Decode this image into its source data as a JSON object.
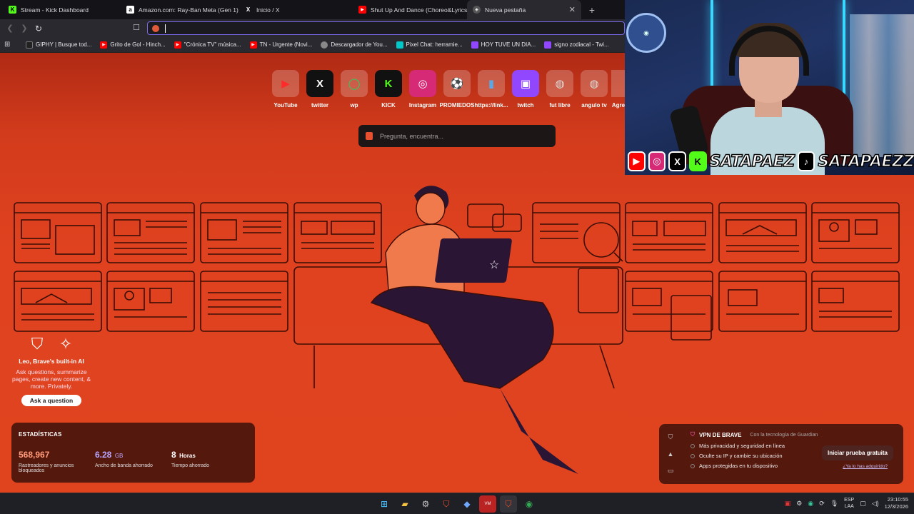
{
  "tabs": [
    {
      "title": "Stream - Kick Dashboard",
      "icon": "kick-icon",
      "color": "#53fc18"
    },
    {
      "title": "Amazon.com: Ray-Ban Meta (Gen 1)",
      "icon": "amazon-icon",
      "color": "#ffffff"
    },
    {
      "title": "Inicio / X",
      "icon": "x-icon",
      "color": "#000000"
    },
    {
      "title": "Shut Up And Dance (Choreo&Lyrics)",
      "icon": "youtube-icon",
      "color": "#ff0000"
    },
    {
      "title": "Nueva pestaña",
      "icon": "brave-icon",
      "color": "#888888",
      "active": true
    }
  ],
  "address_bar": {
    "value": "",
    "placeholder": ""
  },
  "bookmarks": [
    {
      "label": "GIPHY | Busque tod...",
      "color": "#222222",
      "icon": "giphy-icon"
    },
    {
      "label": "Grito de Gol - Hinch...",
      "color": "#ff0000",
      "icon": "youtube-icon"
    },
    {
      "label": "\"Crónica TV\" música...",
      "color": "#ff0000",
      "icon": "youtube-icon"
    },
    {
      "label": "TN - Urgente (Novi...",
      "color": "#ff0000",
      "icon": "youtube-icon"
    },
    {
      "label": "Descargador de You...",
      "color": "#cccccc",
      "icon": "globe-icon"
    },
    {
      "label": "Pixel Chat: herramie...",
      "color": "#00c8c8",
      "icon": "pixel-icon"
    },
    {
      "label": "HOY TUVE UN DIA...",
      "color": "#9146ff",
      "icon": "twitch-icon"
    },
    {
      "label": "signo zodiacal - Twi...",
      "color": "#9146ff",
      "icon": "twitch-icon"
    }
  ],
  "top_sites": [
    {
      "label": "YouTube",
      "glyph": "▶",
      "color": "#ff0000"
    },
    {
      "label": "twitter",
      "glyph": "X",
      "color": "#ffffff"
    },
    {
      "label": "wp",
      "glyph": "◯",
      "color": "#25d366"
    },
    {
      "label": "KICK",
      "glyph": "K",
      "color": "#53fc18"
    },
    {
      "label": "Instagram",
      "glyph": "◎",
      "color": "#e1306c"
    },
    {
      "label": "PROMIEDOS",
      "glyph": "⚽",
      "color": "#2e9d3a"
    },
    {
      "label": "https://link...",
      "glyph": "▮",
      "color": "#5aa9e6"
    },
    {
      "label": "twitch",
      "glyph": "▣",
      "color": "#9146ff"
    },
    {
      "label": "fut libre",
      "glyph": "◍",
      "color": "#cccccc"
    },
    {
      "label": "angulo tv",
      "glyph": "◍",
      "color": "#cccccc"
    },
    {
      "label": "Agre",
      "glyph": "",
      "color": "#cccccc"
    }
  ],
  "search": {
    "placeholder": "Pregunta, encuentra..."
  },
  "leo": {
    "title": "Leo, Brave's built-in AI",
    "description": "Ask questions, summarize pages, create new content, & more. Privately.",
    "button": "Ask a question"
  },
  "stats": {
    "heading": "ESTADÍSTICAS",
    "items": [
      {
        "value": "568,967",
        "unit": "",
        "caption": "Rastreadores y anuncios bloqueados",
        "color": "#ff9a7a"
      },
      {
        "value": "6.28",
        "unit": "GB",
        "caption": "Ancho de banda ahorrado",
        "color": "#b9a7ff"
      },
      {
        "value": "8",
        "unit": "Horas",
        "caption": "Tiempo ahorrado",
        "color": "#ffffff"
      }
    ]
  },
  "vpn": {
    "title": "VPN DE BRAVE",
    "powered": "Con la tecnología de Guardian",
    "features": [
      "Más privacidad y seguridad en línea",
      "Oculte su IP y cambie su ubicación",
      "Apps protegidas en tu dispositivo"
    ],
    "cta": "Iniciar prueba gratuita",
    "already": "¿Ya lo has adquirido?"
  },
  "overlay": {
    "handle1": "SATAPAEZ",
    "handle2": "SATAPAEZZ"
  },
  "taskbar": {
    "lang": "ESP",
    "lang2": "LAA",
    "time": "23:10:55",
    "date": "12/3/2026"
  }
}
